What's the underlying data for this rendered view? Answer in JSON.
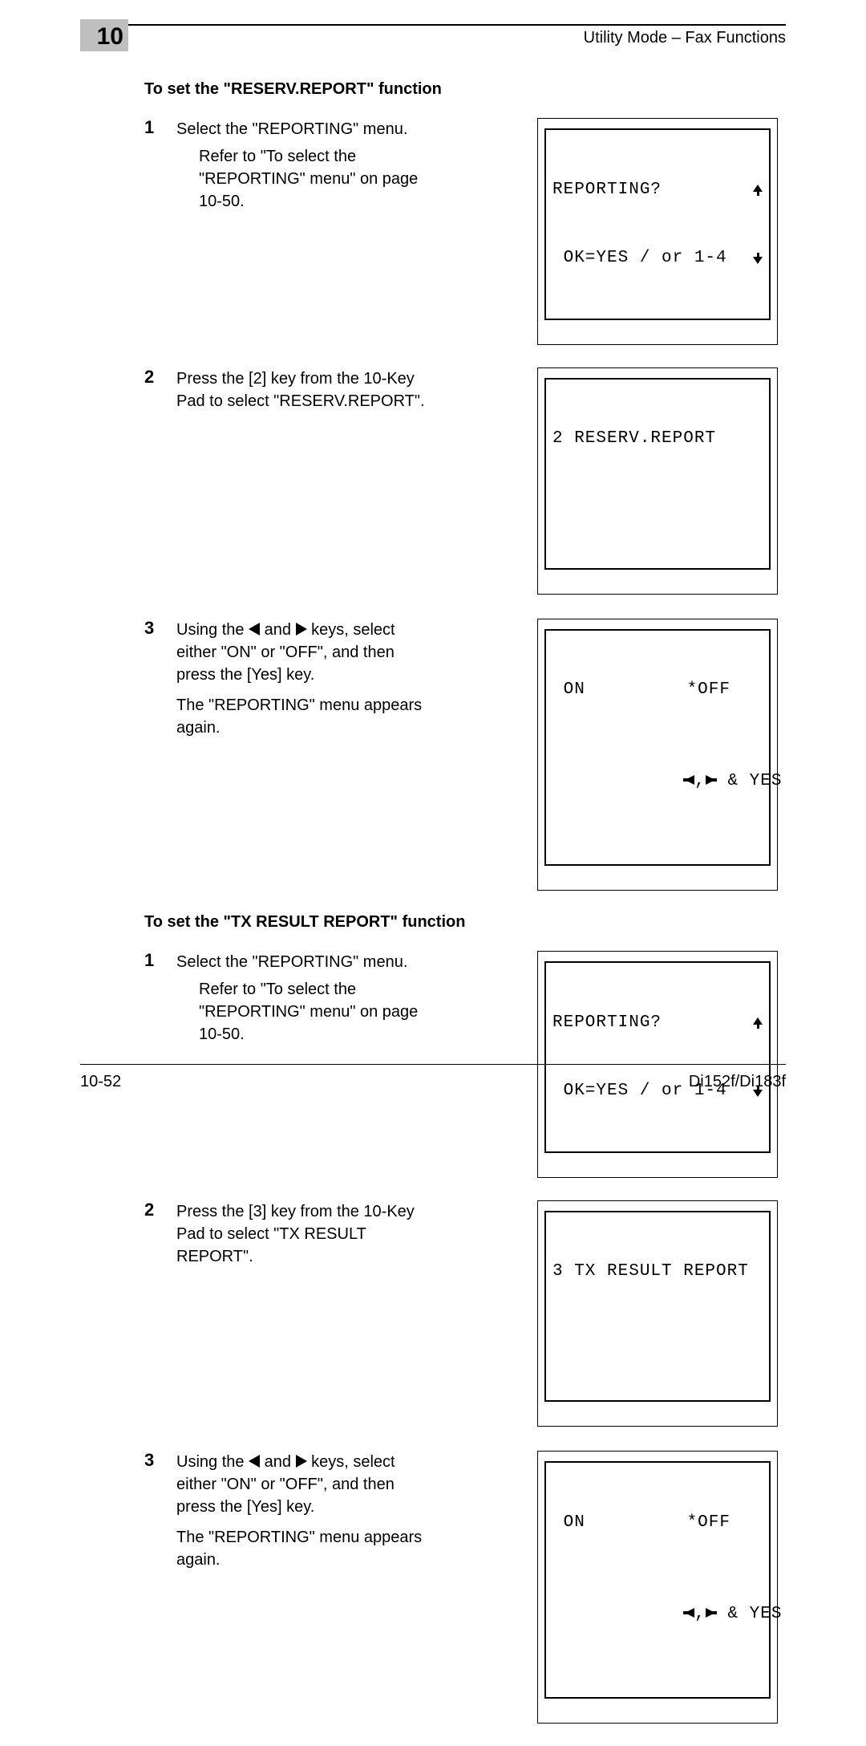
{
  "header": {
    "chapter_number": "10",
    "title": "Utility Mode – Fax Functions"
  },
  "sections": [
    {
      "title": "To set the \"RESERV.REPORT\" function",
      "steps": [
        {
          "num": "1",
          "text": "Select the \"REPORTING\" menu.",
          "sub": "Refer to \"To select the \"REPORTING\" menu\" on page 10-50.",
          "lcd": {
            "type": "reporting",
            "line1": "REPORTING?",
            "line2": " OK=YES / or 1-4"
          }
        },
        {
          "num": "2",
          "text": "Press the [2] key from the 10-Key Pad to select \"RESERV.REPORT\".",
          "lcd": {
            "type": "single",
            "line1": "2 RESERV.REPORT"
          }
        },
        {
          "num": "3",
          "text_pre": "Using the ",
          "text_mid": " and ",
          "text_post": " keys, select either \"ON\" or \"OFF\", and then press the [Yes] key.",
          "after": "The \"REPORTING\" menu appears again.",
          "lcd": {
            "type": "onoff",
            "on": " ON",
            "off": "*OFF",
            "hint": " & YES"
          }
        }
      ]
    },
    {
      "title": "To set the \"TX RESULT REPORT\" function",
      "steps": [
        {
          "num": "1",
          "text": "Select the \"REPORTING\" menu.",
          "sub": "Refer to \"To select the \"REPORTING\" menu\" on page 10-50.",
          "lcd": {
            "type": "reporting",
            "line1": "REPORTING?",
            "line2": " OK=YES / or 1-4"
          }
        },
        {
          "num": "2",
          "text": "Press the [3] key from the 10-Key Pad to select \"TX RESULT REPORT\".",
          "lcd": {
            "type": "single",
            "line1": "3 TX RESULT REPORT"
          }
        },
        {
          "num": "3",
          "text_pre": "Using the ",
          "text_mid": " and ",
          "text_post": " keys, select either \"ON\" or \"OFF\", and then press the [Yes] key.",
          "after": "The \"REPORTING\" menu appears again.",
          "lcd": {
            "type": "onoff",
            "on": " ON",
            "off": "*OFF",
            "hint": " & YES"
          }
        }
      ]
    }
  ],
  "footer": {
    "page_number": "10-52",
    "model": "Di152f/Di183f"
  }
}
